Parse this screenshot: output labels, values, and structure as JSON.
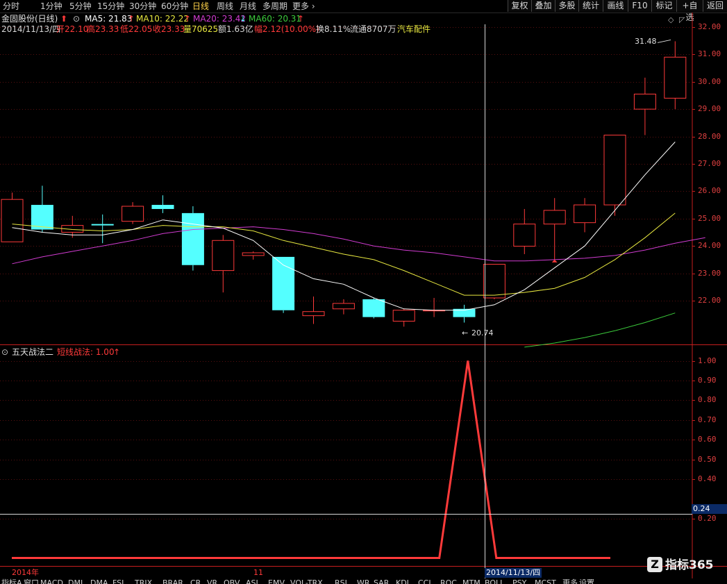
{
  "toolbar": {
    "periods": [
      "分时",
      "1分钟",
      "5分钟",
      "15分钟",
      "30分钟",
      "60分钟",
      "日线",
      "周线",
      "月线",
      "多周期",
      "更多"
    ],
    "active_period": "日线",
    "right_buttons": [
      "复权",
      "叠加",
      "多股",
      "统计",
      "画线",
      "F10",
      "标记",
      "+自选",
      "返回"
    ]
  },
  "header": {
    "title": "金固股份(日线)",
    "ma5": "MA5: 21.83",
    "ma10": "MA10: 22.22",
    "ma20": "MA20: 23.42",
    "ma60": "MA60: 20.31",
    "date": "2014/11/13/四",
    "open": "开22.10",
    "high": "高23.33",
    "low": "低22.05",
    "close": "收23.33",
    "volume": "量70625",
    "amount": "额1.63亿",
    "change": "幅2.12(10.00%)",
    "turnover": "换8.11%",
    "float": "流通8707万",
    "sector": "汽车配件"
  },
  "colors": {
    "up": "#ff3a3a",
    "down": "#54ffff",
    "ma5": "#ffffff",
    "ma10": "#e8e840",
    "ma20": "#d23cd2",
    "ma60": "#3ccc3c",
    "axis": "#c81e1e",
    "grid": "#5a1010"
  },
  "indicator": {
    "name": "五天战法二",
    "line_label": "短线战法: 1.00"
  },
  "labels": {
    "high_mark": "31.48",
    "low_mark": "20.74",
    "cursor_value": "0.24",
    "cursor_date": "2014/11/13/四",
    "year_label": "2014年",
    "month_label": "11"
  },
  "logo_text": "指标365",
  "tabs": [
    "指标A",
    "窗口",
    "MACD",
    "DMI",
    "DMA",
    "FSL",
    "TRIX",
    "BRAR",
    "CR",
    "VR",
    "OBV",
    "ASI",
    "EMV",
    "VOL-TRX",
    "RSI",
    "WR",
    "SAR",
    "KDJ",
    "CCI",
    "ROC",
    "MTM",
    "BOLL",
    "PSY",
    "MCST",
    "更多",
    "设置"
  ],
  "chart_data": [
    {
      "type": "candlestick",
      "y_ticks": [
        22,
        23,
        24,
        25,
        26,
        27,
        28,
        29,
        30,
        31,
        32
      ],
      "ylim": [
        20.4,
        32.1
      ],
      "candles": [
        {
          "o": 24.15,
          "c": 25.7,
          "h": 25.95,
          "l": 24.15
        },
        {
          "o": 25.5,
          "c": 24.6,
          "h": 26.2,
          "l": 24.5
        },
        {
          "o": 24.5,
          "c": 24.75,
          "h": 25.1,
          "l": 24.3
        },
        {
          "o": 24.8,
          "c": 24.75,
          "h": 25.15,
          "l": 24.1
        },
        {
          "o": 24.9,
          "c": 25.45,
          "h": 25.6,
          "l": 24.8
        },
        {
          "o": 25.5,
          "c": 25.35,
          "h": 25.85,
          "l": 25.2
        },
        {
          "o": 25.2,
          "c": 23.3,
          "h": 25.45,
          "l": 23.1
        },
        {
          "o": 23.1,
          "c": 24.2,
          "h": 24.4,
          "l": 22.3
        },
        {
          "o": 23.65,
          "c": 23.75,
          "h": 23.8,
          "l": 23.5
        },
        {
          "o": 23.6,
          "c": 21.65,
          "h": 23.6,
          "l": 21.55
        },
        {
          "o": 21.45,
          "c": 21.6,
          "h": 22.15,
          "l": 21.15
        },
        {
          "o": 21.7,
          "c": 21.9,
          "h": 22.05,
          "l": 21.5
        },
        {
          "o": 22.05,
          "c": 21.4,
          "h": 22.1,
          "l": 21.35
        },
        {
          "o": 21.25,
          "c": 21.65,
          "h": 21.7,
          "l": 21.05
        },
        {
          "o": 21.65,
          "c": 21.65,
          "h": 22.1,
          "l": 21.4
        },
        {
          "o": 21.7,
          "c": 21.4,
          "h": 21.85,
          "l": 21.2
        },
        {
          "o": 22.1,
          "c": 23.33,
          "h": 23.33,
          "l": 22.05
        },
        {
          "o": 23.99,
          "c": 24.8,
          "h": 25.35,
          "l": 23.7
        },
        {
          "o": 24.8,
          "c": 25.3,
          "h": 25.75,
          "l": 23.5
        },
        {
          "o": 24.85,
          "c": 25.5,
          "h": 25.75,
          "l": 24.5
        },
        {
          "o": 25.5,
          "c": 28.05,
          "h": 28.05,
          "l": 25.1
        },
        {
          "o": 29.0,
          "c": 29.55,
          "h": 30.15,
          "l": 28.05
        },
        {
          "o": 29.4,
          "c": 30.9,
          "h": 31.48,
          "l": 29.0
        }
      ],
      "ma5": [
        24.67,
        24.5,
        24.4,
        24.4,
        24.6,
        24.95,
        24.8,
        24.65,
        24.2,
        23.3,
        22.8,
        22.6,
        22.1,
        21.7,
        21.65,
        21.65,
        21.85,
        22.4,
        23.2,
        24.0,
        25.3,
        26.6,
        27.8
      ],
      "ma10": [
        24.8,
        24.7,
        24.6,
        24.55,
        24.6,
        24.75,
        24.7,
        24.7,
        24.55,
        24.2,
        23.95,
        23.7,
        23.5,
        23.1,
        22.65,
        22.2,
        22.2,
        22.3,
        22.45,
        22.85,
        23.5,
        24.3,
        25.2
      ],
      "ma20": [
        23.35,
        23.6,
        23.8,
        24.0,
        24.2,
        24.45,
        24.6,
        24.65,
        24.7,
        24.6,
        24.45,
        24.25,
        24.0,
        23.85,
        23.75,
        23.6,
        23.45,
        23.45,
        23.5,
        23.55,
        23.65,
        23.85,
        24.1,
        24.3
      ],
      "ma60": [
        null,
        null,
        null,
        null,
        null,
        null,
        null,
        null,
        null,
        null,
        null,
        null,
        null,
        null,
        null,
        null,
        null,
        20.3,
        20.45,
        20.65,
        20.9,
        21.2,
        21.55
      ]
    },
    {
      "type": "line",
      "name": "短线战法",
      "y_ticks": [
        0.2,
        0.4,
        0.5,
        0.6,
        0.7,
        0.8,
        0.9,
        1.0
      ],
      "ylim": [
        -0.03,
        1.03
      ],
      "values": [
        0,
        0,
        0,
        0,
        0,
        0,
        0,
        0,
        0,
        0,
        0,
        0,
        0,
        0,
        0,
        0,
        1,
        0,
        0,
        0,
        0,
        0
      ]
    }
  ]
}
